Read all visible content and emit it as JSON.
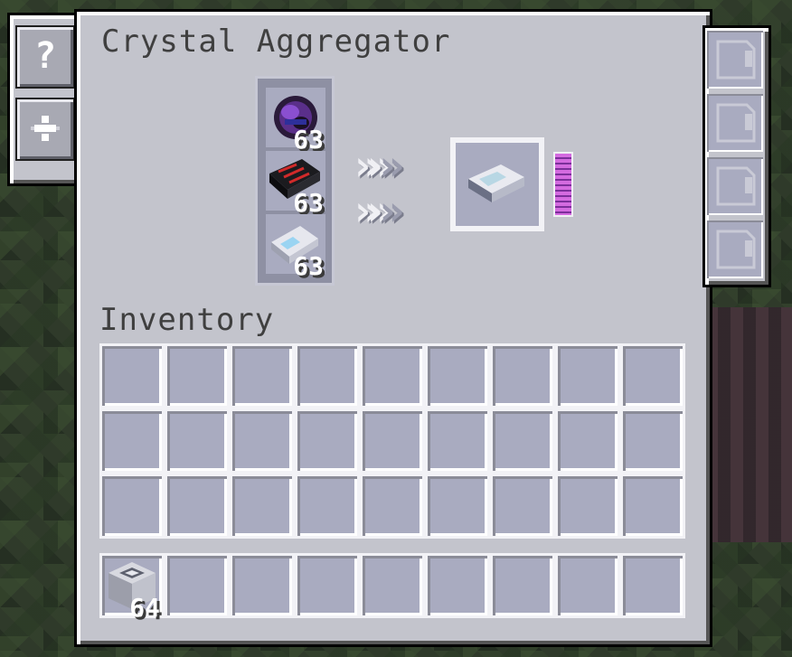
{
  "window": {
    "title": "Crystal Aggregator",
    "inventory_label": "Inventory"
  },
  "tabs": [
    {
      "label": "?",
      "icon": "help-icon"
    },
    {
      "label": "",
      "icon": "priority-icon"
    }
  ],
  "inputs": [
    {
      "item": "ender-dust",
      "count": "63"
    },
    {
      "item": "circuit-plate",
      "count": "63"
    },
    {
      "item": "crystal-shard",
      "count": "63"
    }
  ],
  "output": {
    "item": "fluix-crystal"
  },
  "energy": {
    "fill": 1.0,
    "color": "#c25bd8"
  },
  "upgrade_slots": 4,
  "hotbar": [
    {
      "item": "machine-block",
      "count": "64"
    }
  ],
  "colors": {
    "panel": "#c3c4cc",
    "slot": "#a9abc0",
    "text": "#3f3f3f"
  }
}
